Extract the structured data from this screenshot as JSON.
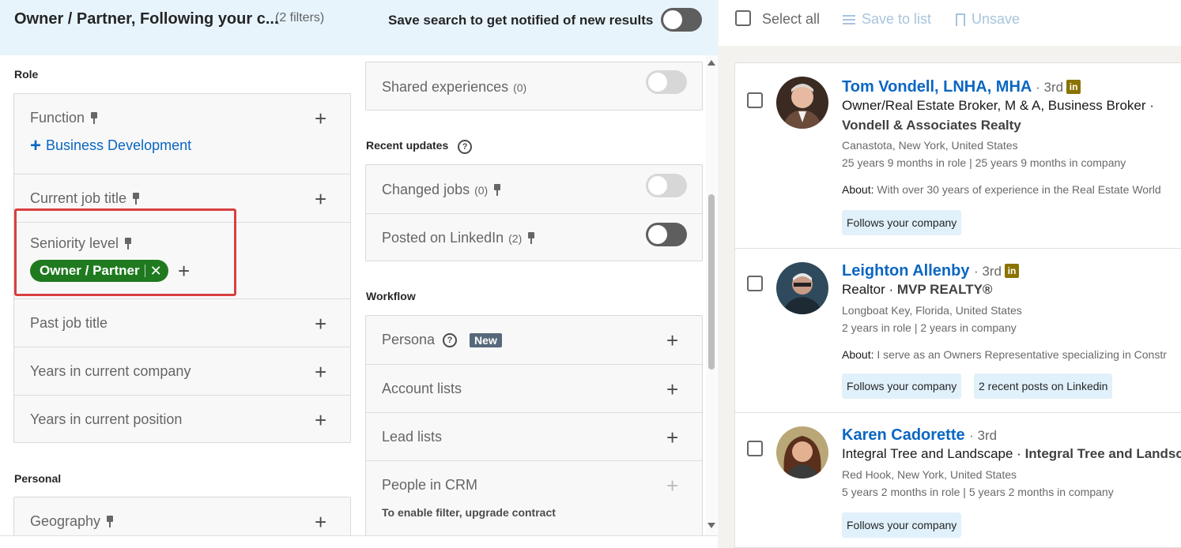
{
  "search": {
    "title": "Owner / Partner, Following your c...",
    "filter_count": "(2 filters)",
    "save_label": "Save search to get notified of new results"
  },
  "sections": {
    "role": "Role",
    "personal": "Personal",
    "recent_updates": "Recent updates",
    "workflow": "Workflow"
  },
  "role_filters": {
    "function": "Function",
    "function_selected": "Business Development",
    "current_job_title": "Current job title",
    "seniority_level": "Seniority level",
    "seniority_pill": "Owner / Partner",
    "past_job_title": "Past job title",
    "years_company": "Years in current company",
    "years_position": "Years in current position"
  },
  "personal_filters": {
    "geography": "Geography"
  },
  "spotlight_filters": {
    "shared_experiences": "Shared experiences",
    "shared_experiences_count": "(0)"
  },
  "recent_updates": {
    "changed_jobs": "Changed jobs",
    "changed_jobs_count": "(0)",
    "posted_linkedin": "Posted on LinkedIn",
    "posted_linkedin_count": "(2)"
  },
  "workflow": {
    "persona": "Persona",
    "persona_badge": "New",
    "account_lists": "Account lists",
    "lead_lists": "Lead lists",
    "people_in_crm": "People in CRM",
    "people_in_crm_note": "To enable filter, upgrade contract"
  },
  "toolbar": {
    "select_all": "Select all",
    "save_to_list": "Save to list",
    "unsave": "Unsave"
  },
  "leads": [
    {
      "name": "Tom Vondell, LNHA, MHA",
      "degree": "· 3rd",
      "title": "Owner/Real Estate Broker, M & A, Business Broker ·",
      "company": "Vondell & Associates Realty",
      "location": "Canastota, New York, United States",
      "tenure": "25 years 9 months in role | 25 years 9 months in company",
      "about_label": "About:",
      "about": "With over 30 years of experience in the Real Estate World",
      "tags": [
        "Follows your company"
      ]
    },
    {
      "name": "Leighton Allenby",
      "degree": "· 3rd",
      "title": "Realtor ·",
      "company": "MVP REALTY®",
      "location": "Longboat Key, Florida, United States",
      "tenure": "2 years in role | 2 years in company",
      "about_label": "About:",
      "about": "I serve as an Owners Representative specializing in Constr",
      "tags": [
        "Follows your company",
        "2 recent posts on Linkedin"
      ]
    },
    {
      "name": "Karen Cadorette",
      "degree": "· 3rd",
      "title": "Integral Tree and Landscape ·",
      "company": "Integral Tree and Landsca",
      "location": "Red Hook, New York, United States",
      "tenure": "5 years 2 months in role | 5 years 2 months in company",
      "tags": [
        "Follows your company"
      ]
    }
  ],
  "colors": {
    "accent": "#0a66c2",
    "pill_green": "#1f7a1f",
    "highlight_red": "#d94040",
    "top_bar": "#e8f4fb"
  }
}
